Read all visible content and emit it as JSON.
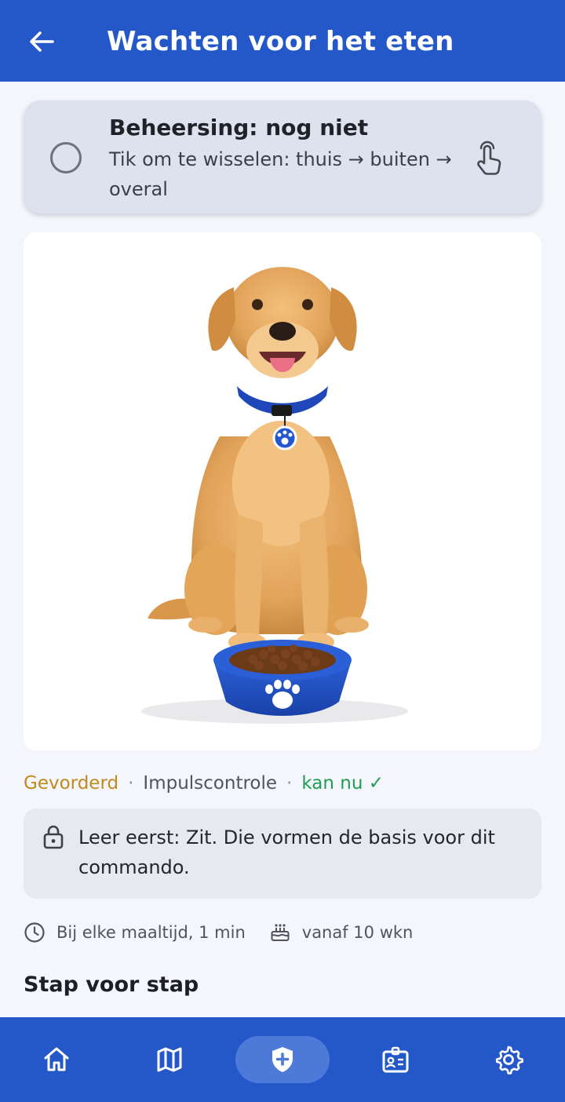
{
  "header": {
    "title": "Wachten voor het eten",
    "back_icon": "arrow-left-icon"
  },
  "mastery": {
    "title": "Beheersing: nog niet",
    "subtitle": "Tik om te wisselen: thuis → buiten → overal",
    "state_icon": "radio-unchecked-icon",
    "action_icon": "tap-hand-icon"
  },
  "hero": {
    "image": "golden labrador sitting behind a blue food bowl with a paw print"
  },
  "meta": {
    "level": "Gevorderd",
    "separator": "·",
    "category": "Impulscontrole",
    "status": "kan nu ✓"
  },
  "prereq": {
    "icon": "lock-icon",
    "text": "Leer eerst: Zit. Die vormen de basis voor dit commando."
  },
  "info": {
    "frequency": "Bij elke maaltijd, 1 min",
    "age": "vanaf 10 wkn"
  },
  "section": {
    "title": "Stap voor stap"
  },
  "nav": {
    "items": [
      {
        "icon": "home-icon"
      },
      {
        "icon": "map-icon"
      },
      {
        "icon": "shield-plus-icon",
        "active": true
      },
      {
        "icon": "id-card-icon"
      },
      {
        "icon": "gear-icon"
      }
    ]
  },
  "colors": {
    "primary": "#2458c9",
    "level": "#c08a1e",
    "status": "#1f9d55",
    "card": "#dde2ee"
  }
}
